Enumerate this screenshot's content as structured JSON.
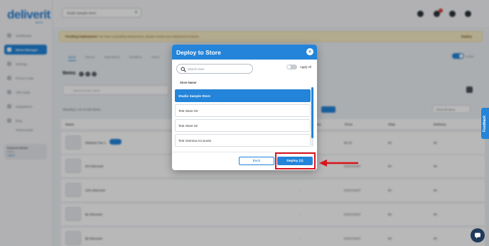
{
  "app": {
    "logo_text": "deliverit",
    "logo_sub": "BETA",
    "store_select_value": "Studio Sample Store",
    "sidebar": {
      "items": [
        {
          "label": "Dashboard"
        },
        {
          "label": "Menu Manager"
        },
        {
          "label": "Settings"
        },
        {
          "label": "Promo Code"
        },
        {
          "label": "Gift Cards"
        },
        {
          "label": "Integrations"
        },
        {
          "label": "Blog"
        },
        {
          "label": "Testimonials"
        }
      ],
      "user": {
        "name": "Deliverit Admin",
        "role": "Admin",
        "logout": "Logout"
      }
    },
    "pending_banner": {
      "title": "Pending Deployment",
      "text": "You have a pending deployment, please review your deployment below.",
      "action": "Deploy"
    },
    "tabs": [
      "Items",
      "Menus",
      "Ingredients",
      "Modifiers",
      "Sizes"
    ],
    "toggle_label": "Active",
    "section_title": "Items",
    "search_placeholder": "Search by item name",
    "showing_text": "Showing 1-10 of 234 Items",
    "show_all_label": "Show All Items",
    "table_headers": [
      "Name",
      "Sizes",
      "Price",
      "Ship",
      "Delivery"
    ],
    "rows": [
      {
        "name": "Delivery Fee 1",
        "size": "",
        "price": "$0.00",
        "ship": "$0",
        "delivery": "$0"
      },
      {
        "name": "5% Discount",
        "size": "-",
        "price": "DISCOUNT",
        "ship": "$0",
        "delivery": "$0"
      },
      {
        "name": "10% Discount",
        "size": "-",
        "price": "DISCOUNT",
        "ship": "$0",
        "delivery": "$0"
      },
      {
        "name": "$1 Discount",
        "size": "-",
        "price": "DISCOUNT",
        "ship": "$0",
        "delivery": "$0"
      },
      {
        "name": "$2 Discount",
        "size": "-",
        "price": "DISCOUNT",
        "ship": "$0",
        "delivery": "$0"
      }
    ],
    "feedback_label": "Feedback"
  },
  "modal": {
    "title": "Deploy to Store",
    "close_symbol": "×",
    "search_placeholder": "Search store",
    "apply_all_label": "Apply All",
    "column_label": "Store Name",
    "stores": [
      {
        "name": "Studio Sample Store",
        "selected": true
      },
      {
        "name": "Test Store 03",
        "selected": false
      },
      {
        "name": "Test Store 02",
        "selected": false
      },
      {
        "name": "Test Gamma Accounts",
        "selected": false
      }
    ],
    "back_label": "Back",
    "deploy_label": "Deploy (1)"
  },
  "colors": {
    "primary": "#2384d9",
    "annotation": "#d9141c",
    "overlay": "rgba(0,0,0,0.28)"
  }
}
